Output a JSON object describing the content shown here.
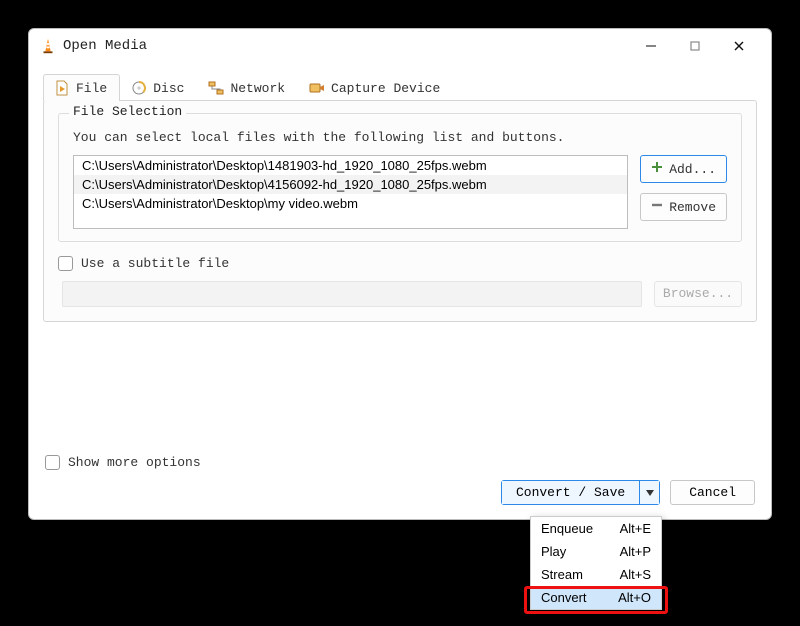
{
  "window": {
    "title": "Open Media"
  },
  "tabs": [
    {
      "label": "File",
      "icon": "file-icon",
      "active": true
    },
    {
      "label": "Disc",
      "icon": "disc-icon"
    },
    {
      "label": "Network",
      "icon": "network-icon"
    },
    {
      "label": "Capture Device",
      "icon": "capture-icon"
    }
  ],
  "file_selection": {
    "legend": "File Selection",
    "help": "You can select local files with the following list and buttons.",
    "files": [
      "C:\\Users\\Administrator\\Desktop\\1481903-hd_1920_1080_25fps.webm",
      "C:\\Users\\Administrator\\Desktop\\4156092-hd_1920_1080_25fps.webm",
      "C:\\Users\\Administrator\\Desktop\\my video.webm"
    ],
    "add_label": "Add...",
    "remove_label": "Remove"
  },
  "subtitle": {
    "label": "Use a subtitle file",
    "browse_label": "Browse..."
  },
  "show_more_label": "Show more options",
  "convert_save_label": "Convert / Save",
  "cancel_label": "Cancel",
  "menu": [
    {
      "label": "Enqueue",
      "accel": "Alt+E"
    },
    {
      "label": "Play",
      "accel": "Alt+P"
    },
    {
      "label": "Stream",
      "accel": "Alt+S"
    },
    {
      "label": "Convert",
      "accel": "Alt+O",
      "highlight": true
    }
  ]
}
